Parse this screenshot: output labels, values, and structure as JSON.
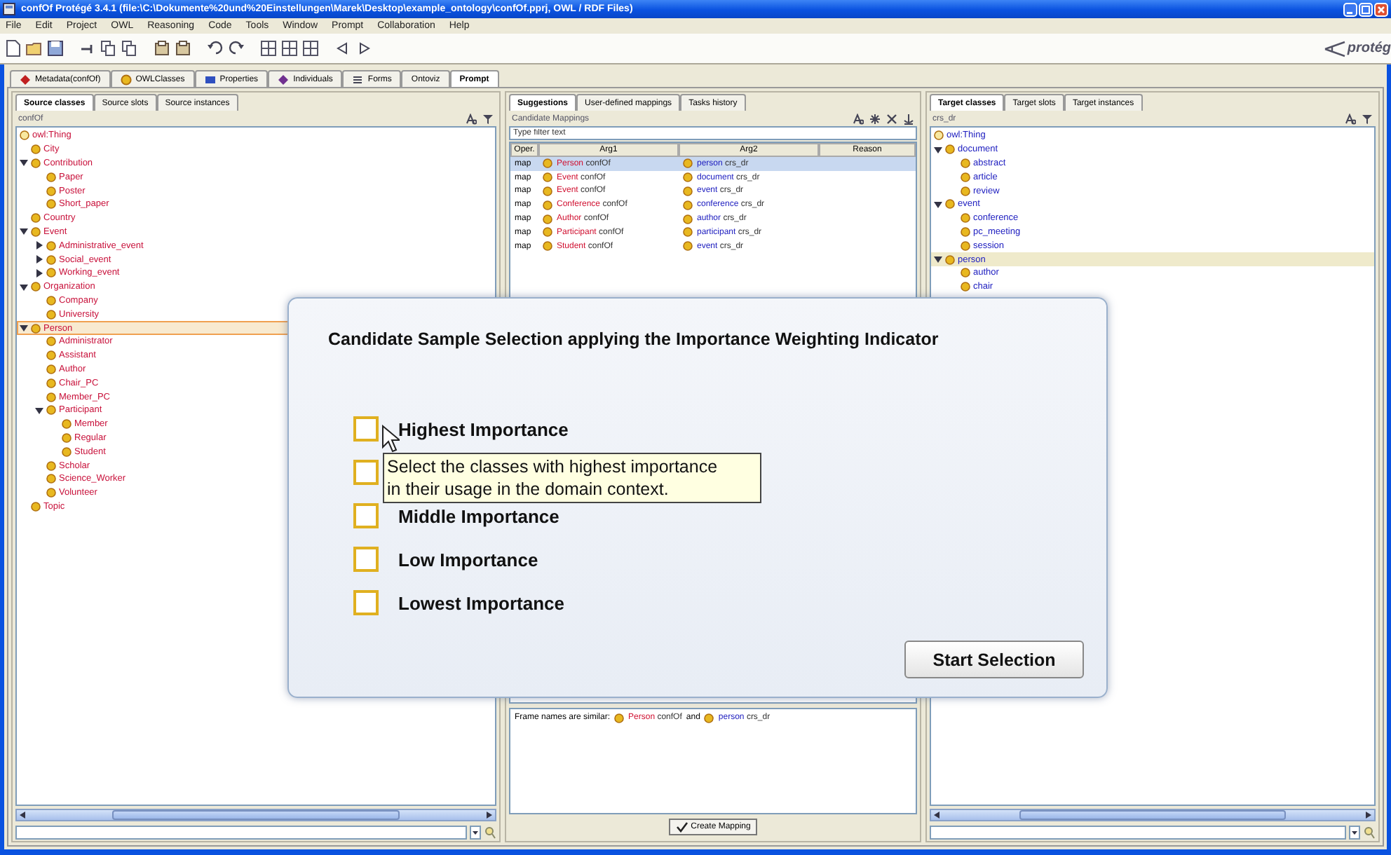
{
  "window": {
    "title": "confOf  Protégé 3.4.1     (file:\\C:\\Dokumente%20und%20Einstellungen\\Marek\\Desktop\\example_ontology\\confOf.pprj, OWL / RDF Files)"
  },
  "menu": [
    "File",
    "Edit",
    "Project",
    "OWL",
    "Reasoning",
    "Code",
    "Tools",
    "Window",
    "Prompt",
    "Collaboration",
    "Help"
  ],
  "logo": "protég",
  "tabs": [
    {
      "label": "Metadata(confOf)",
      "selected": false
    },
    {
      "label": "OWLClasses",
      "selected": false
    },
    {
      "label": "Properties",
      "selected": false
    },
    {
      "label": "Individuals",
      "selected": false
    },
    {
      "label": "Forms",
      "selected": false
    },
    {
      "label": "Ontoviz",
      "selected": false
    },
    {
      "label": "Prompt",
      "selected": true
    }
  ],
  "source": {
    "tabs": [
      {
        "label": "Source classes",
        "selected": true
      },
      {
        "label": "Source slots",
        "selected": false
      },
      {
        "label": "Source instances",
        "selected": false
      }
    ],
    "ontology": "confOf",
    "tree": [
      {
        "label": "owl:Thing",
        "selected": false,
        "children": [
          {
            "label": "City",
            "selected": false
          },
          {
            "label": "Contribution",
            "selected": false,
            "expanded": true,
            "children": [
              {
                "label": "Paper",
                "selected": false
              },
              {
                "label": "Poster",
                "selected": false
              },
              {
                "label": "Short_paper",
                "selected": false
              }
            ]
          },
          {
            "label": "Country",
            "selected": false
          },
          {
            "label": "Event",
            "selected": false,
            "expanded": true,
            "children": [
              {
                "label": "Administrative_event",
                "selected": false,
                "expanded": false
              },
              {
                "label": "Social_event",
                "selected": false,
                "expanded": false
              },
              {
                "label": "Working_event",
                "selected": false,
                "expanded": false
              }
            ]
          },
          {
            "label": "Organization",
            "selected": false,
            "expanded": true,
            "children": [
              {
                "label": "Company",
                "selected": false
              },
              {
                "label": "University",
                "selected": false
              }
            ]
          },
          {
            "label": "Person",
            "selected": true,
            "expanded": true,
            "children": [
              {
                "label": "Administrator",
                "selected": false
              },
              {
                "label": "Assistant",
                "selected": false
              },
              {
                "label": "Author",
                "selected": false
              },
              {
                "label": "Chair_PC",
                "selected": false
              },
              {
                "label": "Member_PC",
                "selected": false
              },
              {
                "label": "Participant",
                "selected": false,
                "expanded": true,
                "children": [
                  {
                    "label": "Member",
                    "selected": false
                  },
                  {
                    "label": "Regular",
                    "selected": false
                  },
                  {
                    "label": "Student",
                    "selected": false
                  }
                ]
              },
              {
                "label": "Scholar",
                "selected": false
              },
              {
                "label": "Science_Worker",
                "selected": false
              },
              {
                "label": "Volunteer",
                "selected": false
              }
            ]
          },
          {
            "label": "Topic",
            "selected": false
          }
        ]
      }
    ]
  },
  "mapping": {
    "tabs": [
      {
        "label": "Suggestions",
        "selected": true
      },
      {
        "label": "User-defined mappings",
        "selected": false
      },
      {
        "label": "Tasks history",
        "selected": false
      }
    ],
    "title": "Candidate Mappings",
    "filter": {
      "placeholder": "Type filter text"
    },
    "columns": [
      "Oper.",
      "Arg1",
      "Arg2",
      "Reason"
    ],
    "rows": [
      {
        "operation": "map",
        "arg1": {
          "name": "Person",
          "ontology": "confOf"
        },
        "arg2": {
          "name": "person",
          "ontology": "crs_dr"
        },
        "selected": true
      },
      {
        "operation": "map",
        "arg1": {
          "name": "Event",
          "ontology": "confOf"
        },
        "arg2": {
          "name": "document",
          "ontology": "crs_dr"
        },
        "selected": false
      },
      {
        "operation": "map",
        "arg1": {
          "name": "Event",
          "ontology": "confOf"
        },
        "arg2": {
          "name": "event",
          "ontology": "crs_dr"
        },
        "selected": false
      },
      {
        "operation": "map",
        "arg1": {
          "name": "Conference",
          "ontology": "confOf"
        },
        "arg2": {
          "name": "conference",
          "ontology": "crs_dr"
        },
        "selected": false
      },
      {
        "operation": "map",
        "arg1": {
          "name": "Author",
          "ontology": "confOf"
        },
        "arg2": {
          "name": "author",
          "ontology": "crs_dr"
        },
        "selected": false
      },
      {
        "operation": "map",
        "arg1": {
          "name": "Participant",
          "ontology": "confOf"
        },
        "arg2": {
          "name": "participant",
          "ontology": "crs_dr"
        },
        "selected": false
      },
      {
        "operation": "map",
        "arg1": {
          "name": "Student",
          "ontology": "confOf"
        },
        "arg2": {
          "name": "event",
          "ontology": "crs_dr"
        },
        "selected": false
      }
    ],
    "explanation": {
      "text": "Frame names are similar:",
      "arg1": {
        "name": "Person",
        "ontology": "confOf"
      },
      "joiner": "and",
      "arg2": {
        "name": "person",
        "ontology": "crs_dr"
      }
    },
    "button": "Create Mapping"
  },
  "target": {
    "tabs": [
      {
        "label": "Target classes",
        "selected": true
      },
      {
        "label": "Target slots",
        "selected": false
      },
      {
        "label": "Target instances",
        "selected": false
      }
    ],
    "ontology": "crs_dr",
    "tree": [
      {
        "label": "owl:Thing",
        "selected": false,
        "children": [
          {
            "label": "document",
            "selected": false,
            "expanded": true,
            "children": [
              {
                "label": "abstract",
                "selected": false
              },
              {
                "label": "article",
                "selected": false
              },
              {
                "label": "review",
                "selected": false
              }
            ]
          },
          {
            "label": "event",
            "selected": false,
            "expanded": true,
            "children": [
              {
                "label": "conference",
                "selected": false
              },
              {
                "label": "pc_meeting",
                "selected": false
              },
              {
                "label": "session",
                "selected": false
              }
            ]
          },
          {
            "label": "person",
            "selected": true,
            "expanded": true,
            "children": [
              {
                "label": "author",
                "selected": false
              },
              {
                "label": "chair",
                "selected": false
              }
            ]
          }
        ]
      }
    ]
  },
  "dialog": {
    "title": "Candidate Sample Selection applying the Importance Weighting Indicator",
    "options": [
      {
        "label": "Highest Importance",
        "checked": false
      },
      {
        "checked": false
      },
      {
        "label": "Middle Importance",
        "checked": false
      },
      {
        "label": "Low Importance",
        "checked": false
      },
      {
        "label": "Lowest Importance",
        "checked": false
      }
    ],
    "tooltip": "Select the classes with highest importance\nin their usage in the domain context.",
    "button": "Start Selection"
  }
}
